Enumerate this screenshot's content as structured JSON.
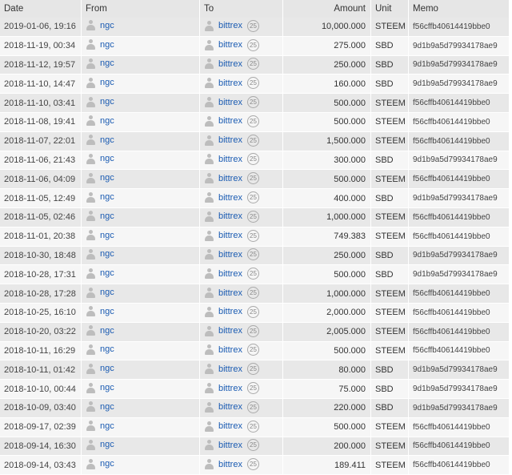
{
  "headers": {
    "date": "Date",
    "from": "From",
    "to": "To",
    "amount": "Amount",
    "unit": "Unit",
    "memo": "Memo"
  },
  "rows": [
    {
      "date": "2019-01-06, 19:16",
      "from": "ngc",
      "to": "bittrex",
      "rep": "25",
      "amount": "10,000.000",
      "unit": "STEEM",
      "memo": "f56cffb40614419bbe0"
    },
    {
      "date": "2018-11-19, 00:34",
      "from": "ngc",
      "to": "bittrex",
      "rep": "25",
      "amount": "275.000",
      "unit": "SBD",
      "memo": "9d1b9a5d79934178ae9"
    },
    {
      "date": "2018-11-12, 19:57",
      "from": "ngc",
      "to": "bittrex",
      "rep": "25",
      "amount": "250.000",
      "unit": "SBD",
      "memo": "9d1b9a5d79934178ae9"
    },
    {
      "date": "2018-11-10, 14:47",
      "from": "ngc",
      "to": "bittrex",
      "rep": "25",
      "amount": "160.000",
      "unit": "SBD",
      "memo": "9d1b9a5d79934178ae9"
    },
    {
      "date": "2018-11-10, 03:41",
      "from": "ngc",
      "to": "bittrex",
      "rep": "25",
      "amount": "500.000",
      "unit": "STEEM",
      "memo": "f56cffb40614419bbe0"
    },
    {
      "date": "2018-11-08, 19:41",
      "from": "ngc",
      "to": "bittrex",
      "rep": "25",
      "amount": "500.000",
      "unit": "STEEM",
      "memo": "f56cffb40614419bbe0"
    },
    {
      "date": "2018-11-07, 22:01",
      "from": "ngc",
      "to": "bittrex",
      "rep": "25",
      "amount": "1,500.000",
      "unit": "STEEM",
      "memo": "f56cffb40614419bbe0"
    },
    {
      "date": "2018-11-06, 21:43",
      "from": "ngc",
      "to": "bittrex",
      "rep": "25",
      "amount": "300.000",
      "unit": "SBD",
      "memo": "9d1b9a5d79934178ae9"
    },
    {
      "date": "2018-11-06, 04:09",
      "from": "ngc",
      "to": "bittrex",
      "rep": "25",
      "amount": "500.000",
      "unit": "STEEM",
      "memo": "f56cffb40614419bbe0"
    },
    {
      "date": "2018-11-05, 12:49",
      "from": "ngc",
      "to": "bittrex",
      "rep": "25",
      "amount": "400.000",
      "unit": "SBD",
      "memo": "9d1b9a5d79934178ae9"
    },
    {
      "date": "2018-11-05, 02:46",
      "from": "ngc",
      "to": "bittrex",
      "rep": "25",
      "amount": "1,000.000",
      "unit": "STEEM",
      "memo": "f56cffb40614419bbe0"
    },
    {
      "date": "2018-11-01, 20:38",
      "from": "ngc",
      "to": "bittrex",
      "rep": "25",
      "amount": "749.383",
      "unit": "STEEM",
      "memo": "f56cffb40614419bbe0"
    },
    {
      "date": "2018-10-30, 18:48",
      "from": "ngc",
      "to": "bittrex",
      "rep": "25",
      "amount": "250.000",
      "unit": "SBD",
      "memo": "9d1b9a5d79934178ae9"
    },
    {
      "date": "2018-10-28, 17:31",
      "from": "ngc",
      "to": "bittrex",
      "rep": "25",
      "amount": "500.000",
      "unit": "SBD",
      "memo": "9d1b9a5d79934178ae9"
    },
    {
      "date": "2018-10-28, 17:28",
      "from": "ngc",
      "to": "bittrex",
      "rep": "25",
      "amount": "1,000.000",
      "unit": "STEEM",
      "memo": "f56cffb40614419bbe0"
    },
    {
      "date": "2018-10-25, 16:10",
      "from": "ngc",
      "to": "bittrex",
      "rep": "25",
      "amount": "2,000.000",
      "unit": "STEEM",
      "memo": "f56cffb40614419bbe0"
    },
    {
      "date": "2018-10-20, 03:22",
      "from": "ngc",
      "to": "bittrex",
      "rep": "25",
      "amount": "2,005.000",
      "unit": "STEEM",
      "memo": "f56cffb40614419bbe0"
    },
    {
      "date": "2018-10-11, 16:29",
      "from": "ngc",
      "to": "bittrex",
      "rep": "25",
      "amount": "500.000",
      "unit": "STEEM",
      "memo": "f56cffb40614419bbe0"
    },
    {
      "date": "2018-10-11, 01:42",
      "from": "ngc",
      "to": "bittrex",
      "rep": "25",
      "amount": "80.000",
      "unit": "SBD",
      "memo": "9d1b9a5d79934178ae9"
    },
    {
      "date": "2018-10-10, 00:44",
      "from": "ngc",
      "to": "bittrex",
      "rep": "25",
      "amount": "75.000",
      "unit": "SBD",
      "memo": "9d1b9a5d79934178ae9"
    },
    {
      "date": "2018-10-09, 03:40",
      "from": "ngc",
      "to": "bittrex",
      "rep": "25",
      "amount": "220.000",
      "unit": "SBD",
      "memo": "9d1b9a5d79934178ae9"
    },
    {
      "date": "2018-09-17, 02:39",
      "from": "ngc",
      "to": "bittrex",
      "rep": "25",
      "amount": "500.000",
      "unit": "STEEM",
      "memo": "f56cffb40614419bbe0"
    },
    {
      "date": "2018-09-14, 16:30",
      "from": "ngc",
      "to": "bittrex",
      "rep": "25",
      "amount": "200.000",
      "unit": "STEEM",
      "memo": "f56cffb40614419bbe0"
    },
    {
      "date": "2018-09-14, 03:43",
      "from": "ngc",
      "to": "bittrex",
      "rep": "25",
      "amount": "189.411",
      "unit": "STEEM",
      "memo": "f56cffb40614419bbe0"
    }
  ],
  "icons": {
    "account": "user-icon"
  },
  "colors": {
    "link": "#1a5bb2",
    "row_odd": "#e8e8e8",
    "row_even": "#f6f6f6",
    "header_bg": "#e6e6e6"
  }
}
